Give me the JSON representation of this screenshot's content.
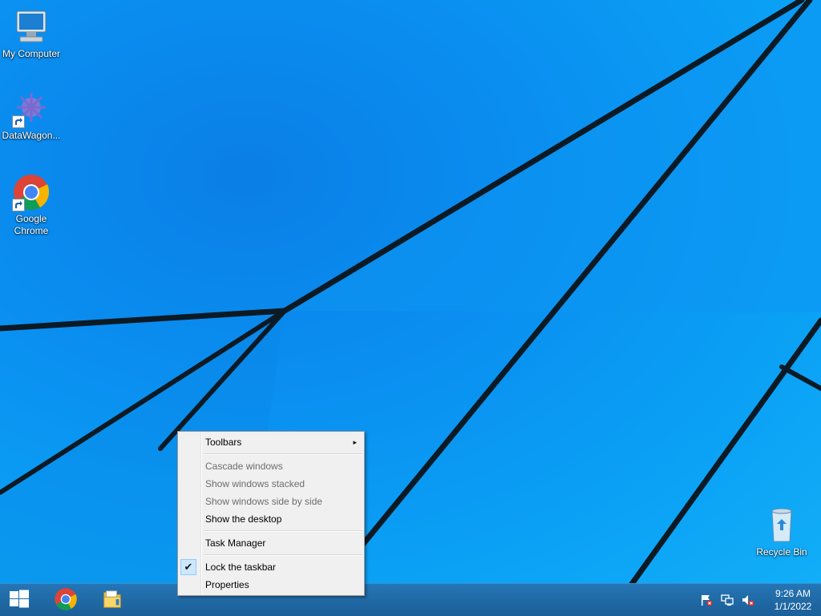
{
  "desktop": {
    "icons": [
      {
        "label": "My Computer",
        "icon": "computer-icon"
      },
      {
        "label": "DataWagon...",
        "icon": "datawagon-icon"
      },
      {
        "label": "Google Chrome",
        "icon": "chrome-icon"
      },
      {
        "label": "Recycle Bin",
        "icon": "recycle-bin-icon"
      }
    ]
  },
  "context_menu": {
    "items": [
      {
        "label": "Toolbars",
        "submenu": true,
        "enabled": true
      },
      {
        "label": "Cascade windows",
        "enabled": false
      },
      {
        "label": "Show windows stacked",
        "enabled": false
      },
      {
        "label": "Show windows side by side",
        "enabled": false
      },
      {
        "label": "Show the desktop",
        "enabled": true
      },
      {
        "label": "Task Manager",
        "enabled": true
      },
      {
        "label": "Lock the taskbar",
        "enabled": true,
        "checked": true
      },
      {
        "label": "Properties",
        "enabled": true
      }
    ],
    "submenu_arrow": "▸",
    "check_mark": "✔"
  },
  "taskbar": {
    "buttons": [
      "windows-logo-icon",
      "chrome-icon",
      "file-explorer-icon"
    ],
    "tray_icons": [
      "action-center-flag-icon",
      "network-icon",
      "volume-muted-icon"
    ],
    "clock": {
      "time": "9:26 AM",
      "date": "1/1/2022"
    }
  },
  "colors": {
    "desktop_blue": "#0a8ef0",
    "taskbar": "#1f6aa8",
    "menu_bg": "#f0f0f0",
    "check_bg": "#cce8ff"
  }
}
